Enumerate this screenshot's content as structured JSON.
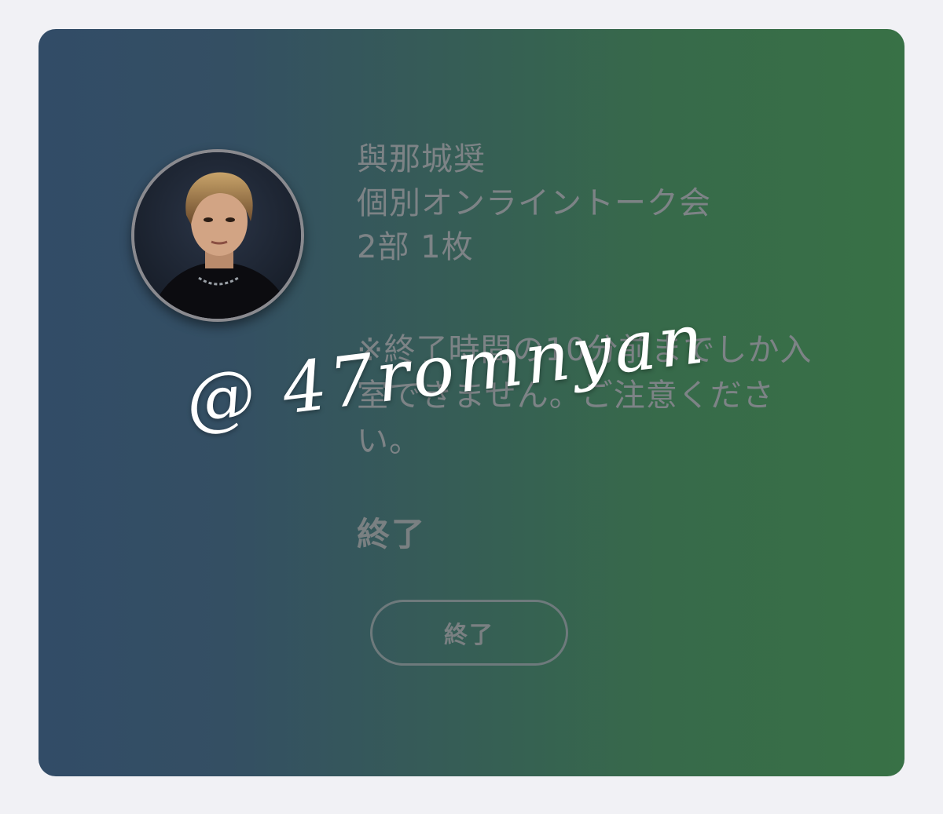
{
  "ticket": {
    "name": "與那城奨",
    "event": "個別オンライントーク会",
    "slot": "2部 1枚",
    "note": "※終了時間の10分前までしか入室できません。ご注意ください。",
    "status": "終了",
    "button_label": "終了"
  },
  "watermark": {
    "text": "@ 47romnyan"
  },
  "colors": {
    "gradient_left": "#324c67",
    "gradient_right": "#387146",
    "muted_text": "#7d8386",
    "page_background": "#f1f1f5"
  }
}
